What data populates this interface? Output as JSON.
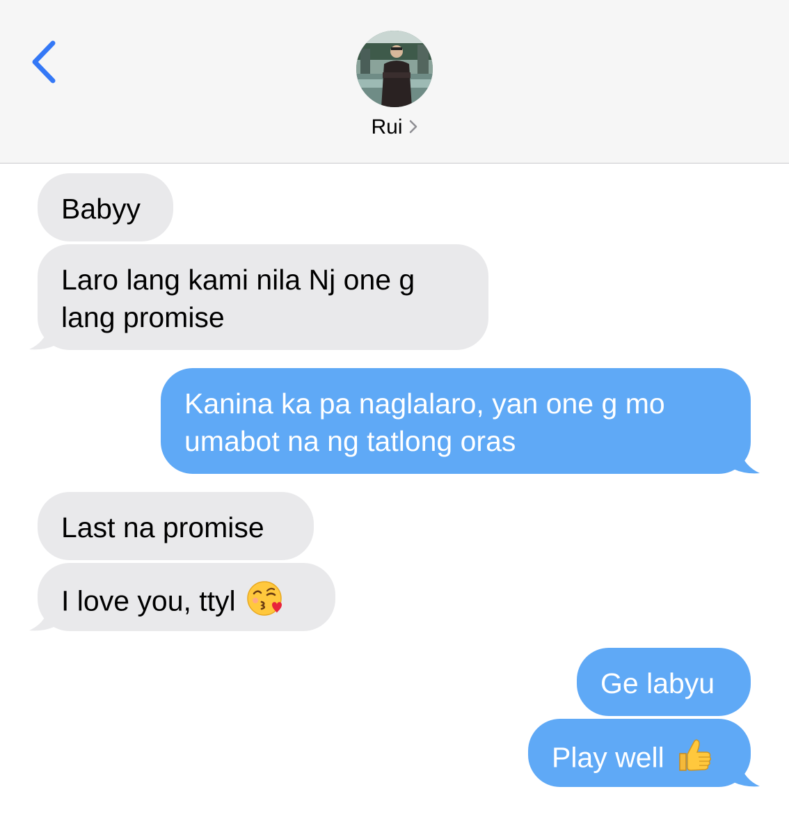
{
  "header": {
    "contact_name": "Rui",
    "back_icon": "chevron-left-icon",
    "accent_color": "#3478f6"
  },
  "messages": [
    {
      "direction": "incoming",
      "lines": [
        "Babyy"
      ]
    },
    {
      "direction": "incoming",
      "lines": [
        "Laro lang kami nila Nj one g",
        "lang promise"
      ]
    },
    {
      "direction": "outgoing",
      "lines": [
        "Kanina ka pa naglalaro, yan one g mo",
        "umabot na ng tatlong oras"
      ]
    },
    {
      "direction": "incoming",
      "lines": [
        "Last na promise"
      ]
    },
    {
      "direction": "incoming",
      "lines": [
        "I love you, ttyl"
      ],
      "emoji": "face-blowing-kiss-emoji"
    },
    {
      "direction": "outgoing",
      "lines": [
        "Ge labyu"
      ]
    },
    {
      "direction": "outgoing",
      "lines": [
        "Play well"
      ],
      "emoji": "thumbs-up-emoji"
    }
  ],
  "colors": {
    "incoming_bubble": "#e9e9eb",
    "outgoing_bubble": "#5fa9f6",
    "header_background": "#f6f6f6"
  }
}
